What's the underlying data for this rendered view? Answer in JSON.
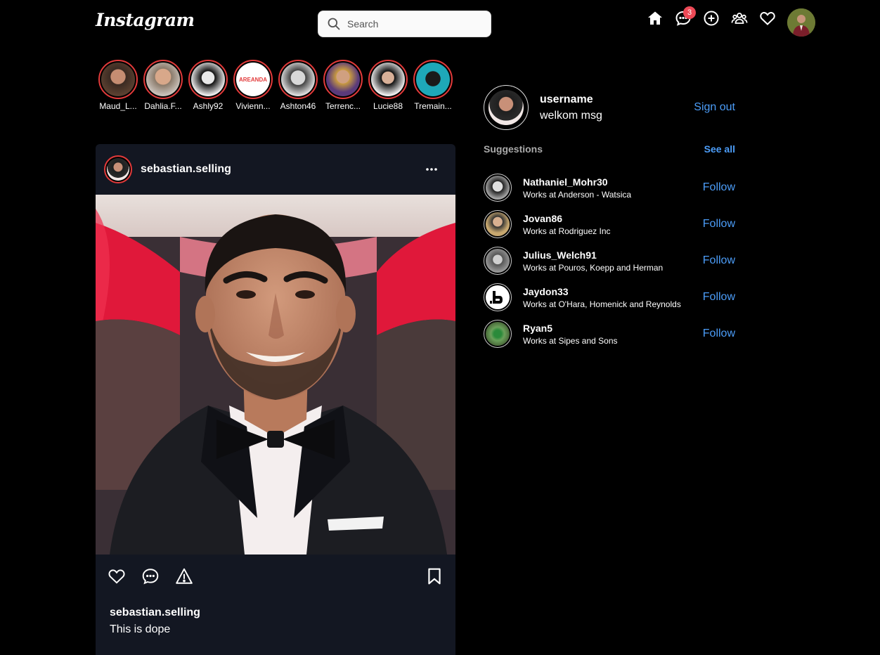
{
  "header": {
    "logo": "Instagram",
    "search_placeholder": "Search",
    "notification_count": "3",
    "icons": [
      "home-icon",
      "messages-icon",
      "add-post-icon",
      "people-icon",
      "heart-icon"
    ]
  },
  "stories": [
    {
      "name": "Maud_L...",
      "color": "#b07a62"
    },
    {
      "name": "Dahlia.F...",
      "color": "#a9917d"
    },
    {
      "name": "Ashly92",
      "color": "#d8d8d8"
    },
    {
      "name": "Vivienn...",
      "color": "#ffffff",
      "logo_text": "AREANDA"
    },
    {
      "name": "Ashton46",
      "color": "#bfbfbf"
    },
    {
      "name": "Terrenc...",
      "color": "#8a5a9a"
    },
    {
      "name": "Lucie88",
      "color": "#e6e6e6"
    },
    {
      "name": "Tremain...",
      "color": "#1ea8b8"
    }
  ],
  "post": {
    "username": "sebastian.selling",
    "caption_user": "sebastian.selling",
    "caption_text": "This is dope",
    "more_icon": "more-horizontal-icon",
    "action_icons": [
      "heart-icon",
      "comment-icon",
      "share-icon",
      "bookmark-icon"
    ]
  },
  "profile": {
    "username": "username",
    "message": "welkom msg",
    "signout_label": "Sign out"
  },
  "suggestions_section": {
    "title": "Suggestions",
    "see_all": "See all"
  },
  "suggestions": [
    {
      "name": "Nathaniel_Mohr30",
      "company": "Works at Anderson - Watsica",
      "follow": "Follow",
      "color": "#9a9a9a"
    },
    {
      "name": "Jovan86",
      "company": "Works at Rodriguez Inc",
      "follow": "Follow",
      "color": "#b8a06a"
    },
    {
      "name": "Julius_Welch91",
      "company": "Works at Pouros, Koepp and Herman",
      "follow": "Follow",
      "color": "#888888"
    },
    {
      "name": "Jaydon33",
      "company": "Works at O'Hara, Homenick and Reynolds",
      "follow": "Follow",
      "color": "#ffffff"
    },
    {
      "name": "Ryan5",
      "company": "Works at Sipes and Sons",
      "follow": "Follow",
      "color": "#4a7a3a"
    }
  ]
}
